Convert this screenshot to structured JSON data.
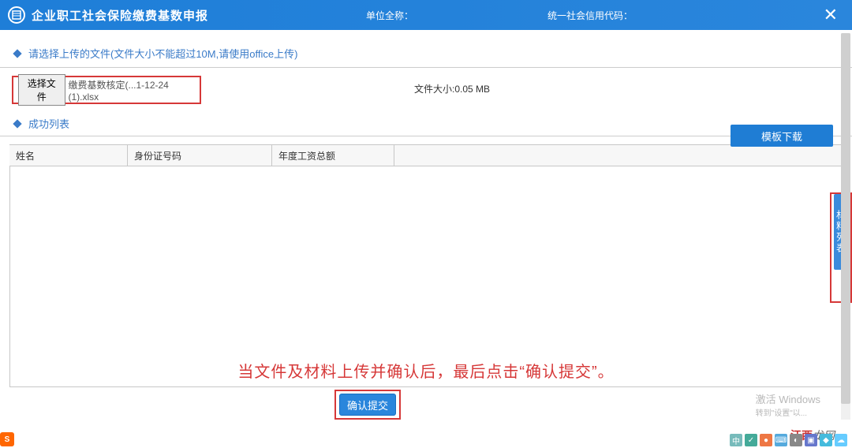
{
  "header": {
    "title": "企业职工社会保险缴费基数申报",
    "unit_label": "单位全称：",
    "code_label": "统一社会信用代码：",
    "close": "✕"
  },
  "section1": {
    "label": "请选择上传的文件(文件大小不能超过10M,请使用office上传)"
  },
  "upload": {
    "choose_label": "选择文件",
    "filename": "缴费基数核定(...1-12-24 (1).xlsx",
    "size_text": "文件大小:0.05 MB"
  },
  "buttons": {
    "template_download": "模板下载",
    "submit": "确认提交"
  },
  "section2": {
    "label": "成功列表"
  },
  "table": {
    "columns": [
      "姓名",
      "身份证号码",
      "年度工资总额",
      ""
    ]
  },
  "instruction_text": "当文件及材料上传并确认后，最后点击“确认提交”。",
  "side_tab": {
    "label": "材料列表",
    "arrow": "→"
  },
  "windows": {
    "line1": "激活 Windows",
    "line2": "转到\"设置\"以..."
  },
  "watermark": "江西龙网",
  "taskbar_s": "S"
}
